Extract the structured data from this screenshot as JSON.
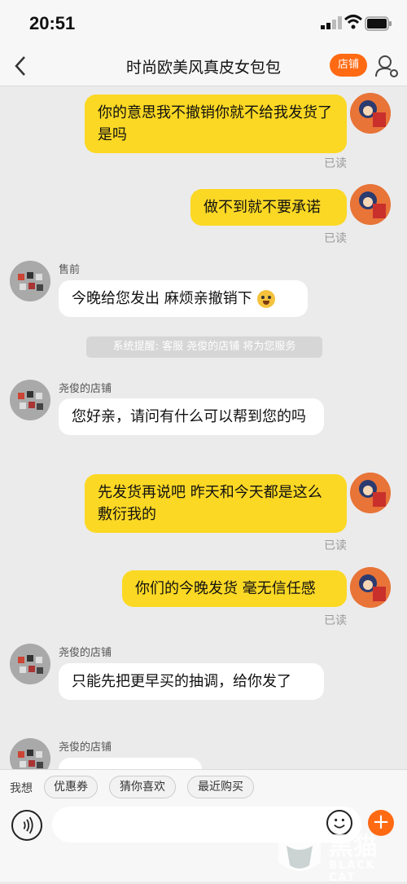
{
  "status": {
    "time": "20:51"
  },
  "nav": {
    "title": "时尚欧美风真皮女包包",
    "store_btn": "店铺"
  },
  "messages": [
    {
      "text": "你的意思我不撤销你就不给我发货了是吗",
      "read": "已读"
    },
    {
      "text": "做不到就不要承诺",
      "read": "已读"
    },
    {
      "sender": "售前",
      "text": "今晚给您发出 麻烦亲撤销下"
    },
    {
      "system": "系统提醒: 客服 尧俊的店铺 将为您服务"
    },
    {
      "sender": "尧俊的店铺",
      "text": "您好亲，请问有什么可以帮到您的吗"
    },
    {
      "text": "先发货再说吧 昨天和今天都是这么敷衍我的",
      "read": "已读"
    },
    {
      "text": "你们的今晚发货 毫无信任感",
      "read": "已读"
    },
    {
      "sender": "尧俊的店铺",
      "text": "只能先把更早买的抽调，给你发了"
    },
    {
      "sender": "尧俊的店铺"
    }
  ],
  "quick": {
    "label": "我想",
    "options": [
      "优惠券",
      "猜你喜欢",
      "最近购买"
    ]
  },
  "input": {
    "placeholder": ""
  },
  "watermark": {
    "text": "黑猫",
    "sub": "BLACK CAT"
  },
  "colors": {
    "my_bubble": "#fbd824",
    "accent": "#ff6a13"
  }
}
